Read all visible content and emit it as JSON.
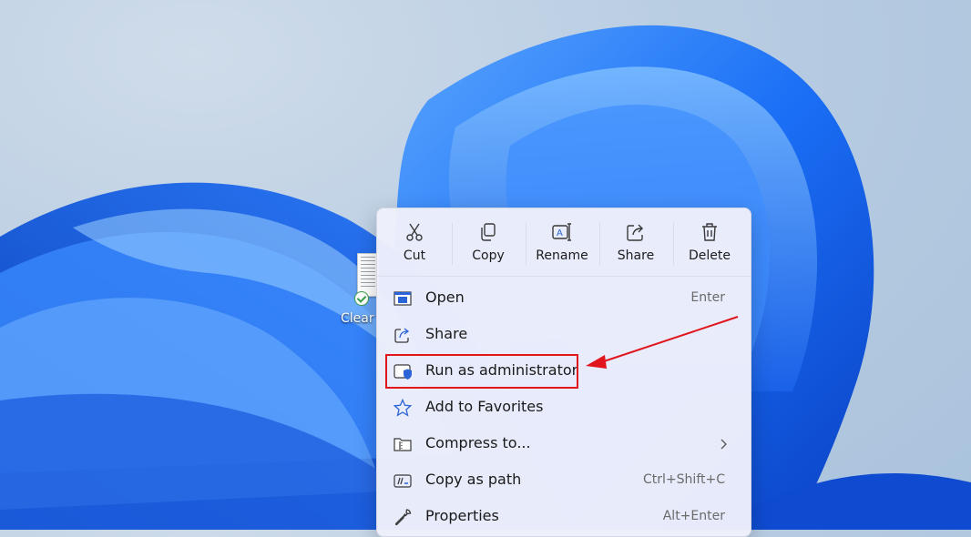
{
  "desktop": {
    "icon_label": "Clear"
  },
  "context_menu": {
    "toolbar": [
      {
        "label": "Cut",
        "icon": "scissors-icon"
      },
      {
        "label": "Copy",
        "icon": "copy-icon"
      },
      {
        "label": "Rename",
        "icon": "rename-icon"
      },
      {
        "label": "Share",
        "icon": "share-icon"
      },
      {
        "label": "Delete",
        "icon": "trash-icon"
      }
    ],
    "items": [
      {
        "label": "Open",
        "shortcut": "Enter",
        "icon": "open-window-icon"
      },
      {
        "label": "Share",
        "shortcut": "",
        "icon": "share-icon"
      },
      {
        "label": "Run as administrator",
        "shortcut": "",
        "icon": "shield-window-icon"
      },
      {
        "label": "Add to Favorites",
        "shortcut": "",
        "icon": "star-icon"
      },
      {
        "label": "Compress to...",
        "shortcut": "",
        "icon": "zip-folder-icon",
        "submenu": true
      },
      {
        "label": "Copy as path",
        "shortcut": "Ctrl+Shift+C",
        "icon": "path-icon"
      },
      {
        "label": "Properties",
        "shortcut": "Alt+Enter",
        "icon": "wrench-icon"
      }
    ]
  },
  "annotation": {
    "highlighted_item": "Run as administrator",
    "color": "#e2141c"
  },
  "colors": {
    "wallpaper_blue": "#1d6cf0",
    "menu_background": "#eef0fb",
    "icon_accent": "#2b64d6"
  }
}
